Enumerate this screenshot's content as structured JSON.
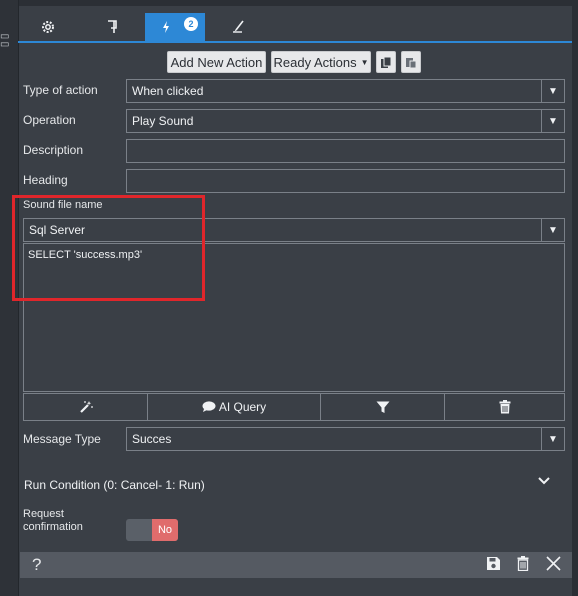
{
  "tabs": [
    {
      "icon": "gear-icon"
    },
    {
      "icon": "flag-icon"
    },
    {
      "icon": "lightning-icon",
      "badge": "2",
      "active": true
    },
    {
      "icon": "brush-icon"
    }
  ],
  "toolbar": {
    "add_new_action": "Add New Action",
    "ready_actions": "Ready Actions",
    "copy_icon": "copy-icon",
    "paste_icon": "paste-icon"
  },
  "form": {
    "type_of_action": {
      "label": "Type of action",
      "value": "When clicked"
    },
    "operation": {
      "label": "Operation",
      "value": "Play Sound"
    },
    "description": {
      "label": "Description",
      "value": ""
    },
    "heading": {
      "label": "Heading",
      "value": ""
    },
    "sound_file_name": {
      "label": "Sound file name"
    },
    "source_type": {
      "value": "Sql Server"
    },
    "query_text": "SELECT 'success.mp3'",
    "query_buttons": {
      "ai_query": "AI Query"
    },
    "message_type": {
      "label": "Message Type",
      "value": "Succes"
    }
  },
  "run_condition": {
    "title": "Run Condition (0: Cancel- 1: Run)"
  },
  "request_confirmation": {
    "label_line1": "Request",
    "label_line2": "confirmation",
    "toggle_text": "No"
  },
  "footer": {
    "help": "?"
  },
  "colors": {
    "accent": "#2d88d6",
    "highlight_box": "#e0262b",
    "toggle_no": "#e06c6c"
  }
}
